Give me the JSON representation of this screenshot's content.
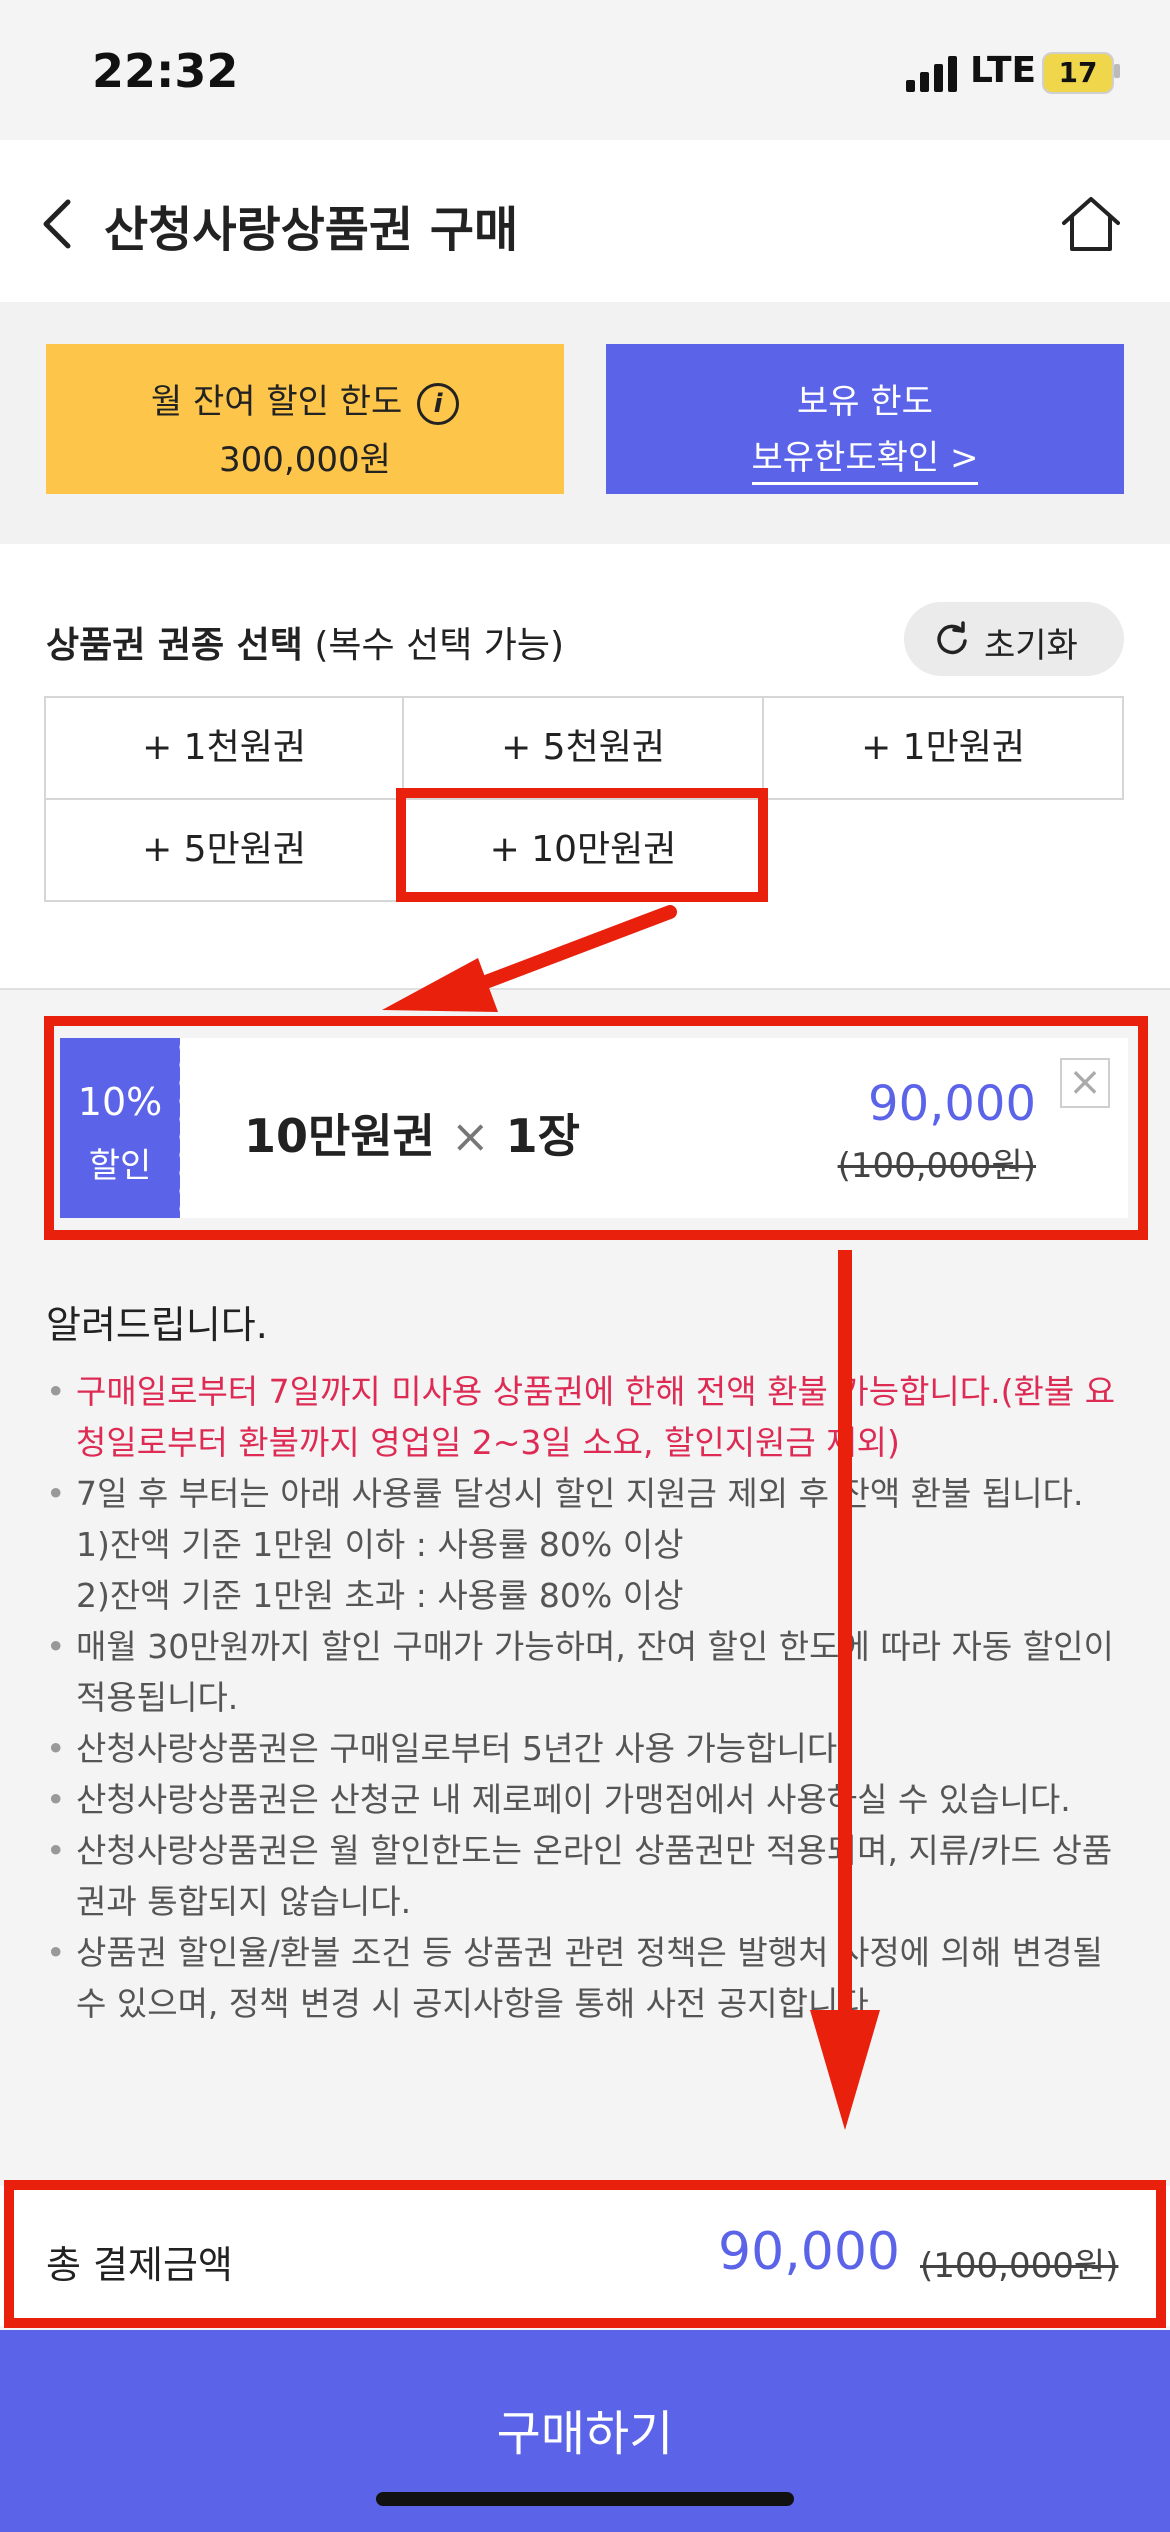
{
  "status_bar": {
    "time": "22:32",
    "network": "LTE",
    "battery": "17"
  },
  "header": {
    "title": "산청사랑상품권 구매"
  },
  "limits": {
    "monthly_label": "월 잔여 할인 한도",
    "monthly_value": "300,000원",
    "owned_label": "보유 한도",
    "owned_link": "보유한도확인 >"
  },
  "selection": {
    "title": "상품권 권종 선택",
    "subtitle": "(복수 선택 가능)",
    "reset_label": "초기화",
    "options": [
      "+ 1천원권",
      "+ 5천원권",
      "+ 1만원권",
      "+ 5만원권",
      "+ 10만원권"
    ]
  },
  "selected": {
    "discount": "10%",
    "discount_label": "할인",
    "name": "10만원권",
    "times": "×",
    "count": "1장",
    "price": "90,000",
    "original": "(100,000원)",
    "close": "×"
  },
  "notice": {
    "title": "알려드립니다.",
    "items": [
      {
        "text": "구매일로부터 7일까지 미사용 상품권에 한해 전액 환불 가능합니다.(환불 요청일로부터 환불까지 영업일 2~3일 소요, 할인지원금 제외)",
        "style": "red"
      },
      {
        "text": "7일 후 부터는 아래 사용률 달성시 할인 지원금 제외 후 잔액 환불 됩니다.",
        "style": "normal"
      },
      {
        "text": "1)잔액 기준 1만원 이하 : 사용률 80% 이상",
        "style": "sub"
      },
      {
        "text": "2)잔액 기준 1만원 초과 : 사용률 80% 이상",
        "style": "sub"
      },
      {
        "text": "매월 30만원까지 할인 구매가 가능하며, 잔여 할인 한도에 따라 자동 할인이 적용됩니다.",
        "style": "normal"
      },
      {
        "text": "산청사랑상품권은 구매일로부터 5년간 사용 가능합니다.",
        "style": "normal"
      },
      {
        "text": "산청사랑상품권은 산청군 내 제로페이 가맹점에서 사용하실 수 있습니다.",
        "style": "normal"
      },
      {
        "text": "산청사랑상품권은 월 할인한도는 온라인 상품권만 적용되며, 지류/카드 상품권과 통합되지 않습니다.",
        "style": "normal"
      },
      {
        "text": "상품권 할인율/환불 조건 등 상품권 관련 정책은 발행처 사정에 의해 변경될 수 있으며, 정책 변경 시 공지사항을 통해 사전 공지합니다.",
        "style": "normal"
      }
    ]
  },
  "total": {
    "label": "총 결제금액",
    "price": "90,000",
    "original": "(100,000원)"
  },
  "purchase": {
    "label": "구매하기"
  },
  "colors": {
    "accent": "#5b64e8",
    "yellow": "#fdc54a",
    "annotation": "#e8200c",
    "warning": "#dd2b54"
  }
}
